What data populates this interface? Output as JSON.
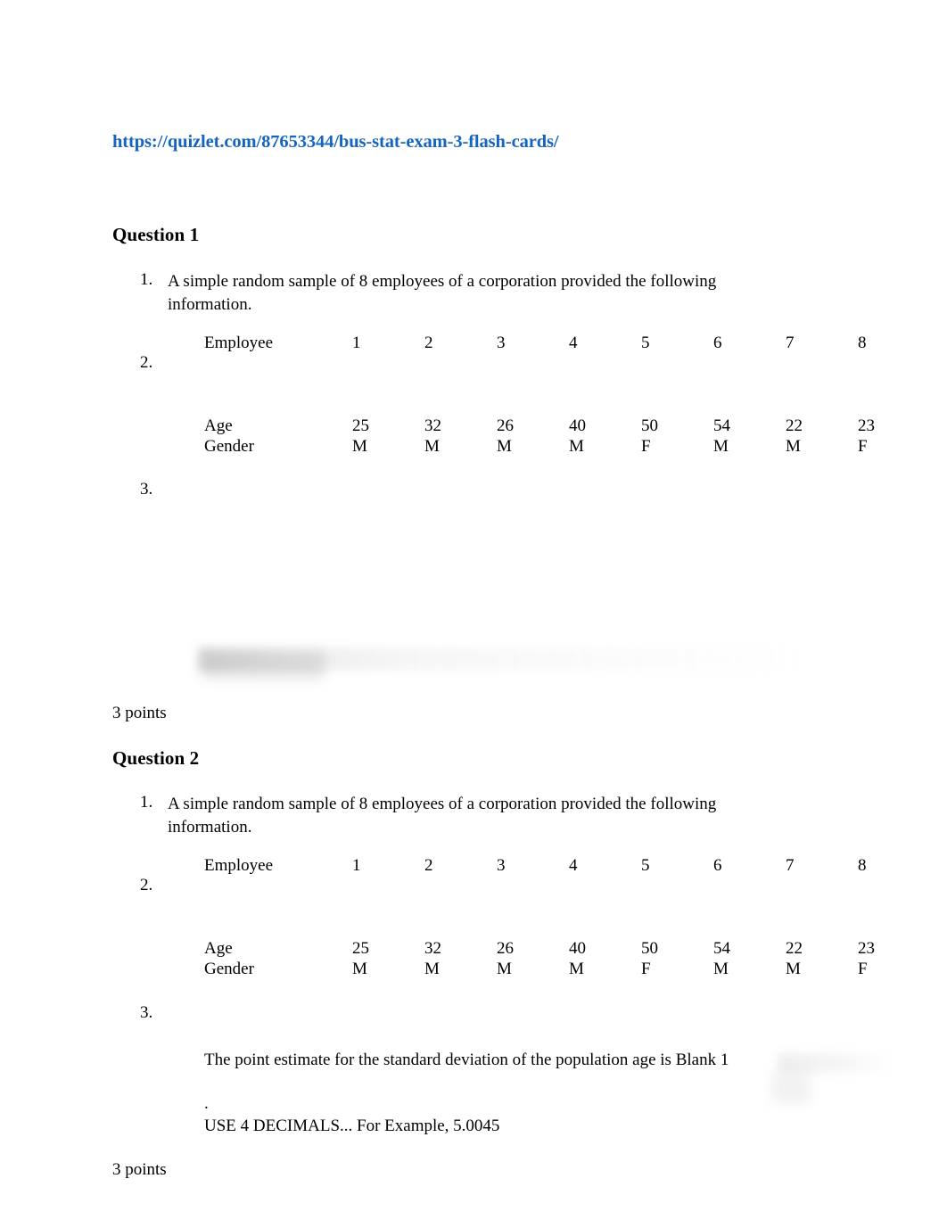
{
  "document": {
    "link_text": "https://quizlet.com/87653344/bus-stat-exam-3-flash-cards/",
    "link_color": "#1565c0"
  },
  "questions": [
    {
      "heading": "Question 1",
      "items": {
        "num_1": "1.",
        "num_2": "2.",
        "num_3": "3.",
        "prompt": "A simple random sample of 8 employees of a corporation provided the following information."
      },
      "table": {
        "rows": [
          {
            "label": "Employee",
            "values": [
              "1",
              "2",
              "3",
              "4",
              "5",
              "6",
              "7",
              "8"
            ]
          },
          {
            "label": "Age",
            "values": [
              "25",
              "32",
              "26",
              "40",
              "50",
              "54",
              "22",
              "23"
            ]
          },
          {
            "label": "Gender",
            "values": [
              "M",
              "M",
              "M",
              "M",
              "F",
              "M",
              "M",
              "F"
            ]
          }
        ]
      },
      "points": "3 points"
    },
    {
      "heading": "Question 2",
      "items": {
        "num_1": "1.",
        "num_2": "2.",
        "num_3": "3.",
        "prompt": "A simple random sample of 8 employees of a corporation provided the following information."
      },
      "table": {
        "rows": [
          {
            "label": "Employee",
            "values": [
              "1",
              "2",
              "3",
              "4",
              "5",
              "6",
              "7",
              "8"
            ]
          },
          {
            "label": "Age",
            "values": [
              "25",
              "32",
              "26",
              "40",
              "50",
              "54",
              "22",
              "23"
            ]
          },
          {
            "label": "Gender",
            "values": [
              "M",
              "M",
              "M",
              "M",
              "F",
              "M",
              "M",
              "F"
            ]
          }
        ]
      },
      "answer": {
        "main": "The point estimate for the standard deviation of the population age is Blank 1",
        "dot": ".",
        "note": "USE 4 DECIMALS... For Example, 5.0045"
      },
      "points": "3 points"
    }
  ]
}
